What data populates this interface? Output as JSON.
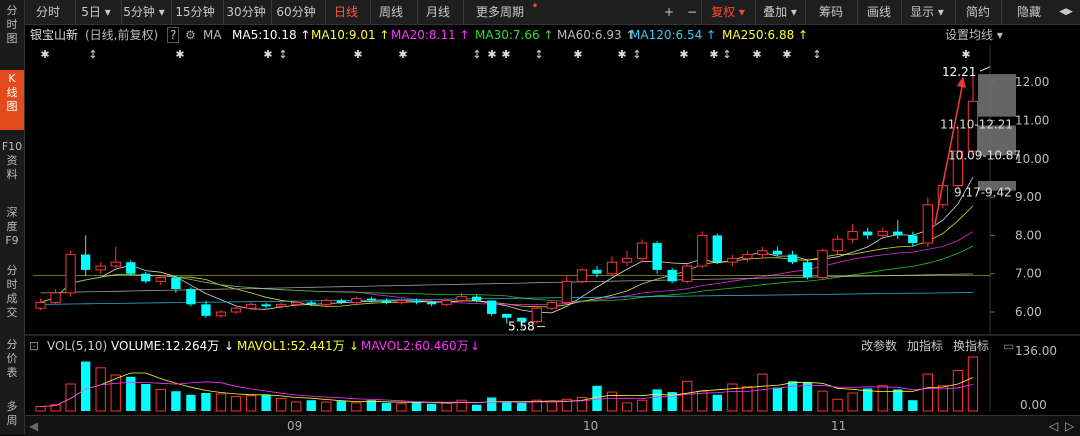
{
  "sidebar": [
    {
      "label": "分\n时\n图",
      "active": false
    },
    {
      "label": "K\n线\n图",
      "active": true
    },
    {
      "label": "F10\n资\n料",
      "active": false
    },
    {
      "label": "深\n度\nF9",
      "active": false
    },
    {
      "label": "分\n时\n成\n交",
      "active": false
    },
    {
      "label": "分\n价\n表",
      "active": false
    },
    {
      "label": "多\n周",
      "active": false
    }
  ],
  "toolbar": {
    "periods": [
      "分时",
      "5日",
      "5分钟",
      "15分钟",
      "30分钟",
      "60分钟",
      "日线",
      "周线",
      "月线",
      "更多周期"
    ],
    "active_period": "日线",
    "right": [
      "+",
      "−",
      "复权",
      "叠加",
      "筹码",
      "画线",
      "显示",
      "简约",
      "隐藏"
    ]
  },
  "info": {
    "stock": "银宝山新",
    "mode": "(日线,前复权)",
    "help": "?",
    "ma_label": "MA",
    "ma": [
      {
        "text": "MA5:10.18",
        "arrow": "↑",
        "color": "#ffffff"
      },
      {
        "text": "MA10:9.01",
        "arrow": "↑",
        "color": "#ffff33"
      },
      {
        "text": "MA20:8.11",
        "arrow": "↑",
        "color": "#ff33ff"
      },
      {
        "text": "MA30:7.66",
        "arrow": "↑",
        "color": "#33dd33"
      },
      {
        "text": "MA60:6.93",
        "arrow": "↑",
        "color": "#bbbbbb"
      },
      {
        "text": "MA120:6.54",
        "arrow": "↑",
        "color": "#33ccff"
      },
      {
        "text": "MA250:6.88",
        "arrow": "↑",
        "color": "#ffff33"
      }
    ],
    "settings": "设置均线"
  },
  "price_axis": [
    "12.00",
    "11.00",
    "10.00",
    "9.00",
    "8.00",
    "7.00",
    "6.00"
  ],
  "annotations": {
    "high": "12.21",
    "low": "5.58",
    "chip_ranges": [
      "11.10-12.21",
      "10.09-10.87",
      "9.17-9.42"
    ]
  },
  "volume": {
    "title": "VOL(5,10)",
    "volume": "VOLUME:12.264万",
    "mavol1": "MAVOL1:52.441万",
    "mavol2": "MAVOL2:60.460万",
    "buttons": [
      "改参数",
      "加指标",
      "换指标"
    ],
    "axis": [
      "136.00",
      "0.00"
    ]
  },
  "months": [
    "09",
    "10",
    "11"
  ],
  "colors": {
    "up": "#ff3333",
    "down": "#00ffff",
    "accent": "#ff5a36"
  },
  "chart_data": {
    "type": "candlestick",
    "candles": [
      [
        6.1,
        6.25,
        6.35,
        6.05
      ],
      [
        6.25,
        6.5,
        6.6,
        6.2
      ],
      [
        6.5,
        7.5,
        7.6,
        6.4
      ],
      [
        7.5,
        7.1,
        8.0,
        6.95
      ],
      [
        7.1,
        7.2,
        7.3,
        7.0
      ],
      [
        7.2,
        7.3,
        7.7,
        7.15
      ],
      [
        7.3,
        7.0,
        7.35,
        6.95
      ],
      [
        7.0,
        6.8,
        7.05,
        6.75
      ],
      [
        6.8,
        6.9,
        6.95,
        6.7
      ],
      [
        6.9,
        6.6,
        6.95,
        6.5
      ],
      [
        6.6,
        6.2,
        6.65,
        6.15
      ],
      [
        6.2,
        5.9,
        6.3,
        5.85
      ],
      [
        5.9,
        6.0,
        6.05,
        5.85
      ],
      [
        6.0,
        6.1,
        6.15,
        5.95
      ],
      [
        6.1,
        6.2,
        6.25,
        6.05
      ],
      [
        6.2,
        6.15,
        6.25,
        6.1
      ],
      [
        6.15,
        6.2,
        6.25,
        6.1
      ],
      [
        6.2,
        6.25,
        6.3,
        6.15
      ],
      [
        6.25,
        6.2,
        6.3,
        6.15
      ],
      [
        6.2,
        6.3,
        6.35,
        6.15
      ],
      [
        6.3,
        6.25,
        6.35,
        6.2
      ],
      [
        6.25,
        6.35,
        6.4,
        6.2
      ],
      [
        6.35,
        6.3,
        6.4,
        6.25
      ],
      [
        6.3,
        6.25,
        6.35,
        6.2
      ],
      [
        6.25,
        6.3,
        6.35,
        6.2
      ],
      [
        6.3,
        6.25,
        6.35,
        6.2
      ],
      [
        6.25,
        6.2,
        6.3,
        6.15
      ],
      [
        6.2,
        6.3,
        6.35,
        6.15
      ],
      [
        6.3,
        6.4,
        6.5,
        6.25
      ],
      [
        6.4,
        6.3,
        6.45,
        6.25
      ],
      [
        6.3,
        5.95,
        6.3,
        5.9
      ],
      [
        5.95,
        5.85,
        5.95,
        5.7
      ],
      [
        5.85,
        5.75,
        5.85,
        5.58
      ],
      [
        5.75,
        6.1,
        6.15,
        5.7
      ],
      [
        6.1,
        6.25,
        6.3,
        6.05
      ],
      [
        6.25,
        6.8,
        6.95,
        6.2
      ],
      [
        6.8,
        7.1,
        7.15,
        6.75
      ],
      [
        7.1,
        7.0,
        7.2,
        6.9
      ],
      [
        7.0,
        7.3,
        7.45,
        6.95
      ],
      [
        7.3,
        7.4,
        7.6,
        7.2
      ],
      [
        7.4,
        7.8,
        7.9,
        7.3
      ],
      [
        7.8,
        7.1,
        7.85,
        7.0
      ],
      [
        7.1,
        6.8,
        7.15,
        6.75
      ],
      [
        6.8,
        7.2,
        7.25,
        6.75
      ],
      [
        7.2,
        8.0,
        8.1,
        7.15
      ],
      [
        8.0,
        7.3,
        8.05,
        7.25
      ],
      [
        7.3,
        7.4,
        7.5,
        7.2
      ],
      [
        7.4,
        7.5,
        7.6,
        7.3
      ],
      [
        7.5,
        7.6,
        7.7,
        7.4
      ],
      [
        7.6,
        7.5,
        7.7,
        7.45
      ],
      [
        7.5,
        7.3,
        7.6,
        7.25
      ],
      [
        7.3,
        6.9,
        7.35,
        6.85
      ],
      [
        6.9,
        7.6,
        7.65,
        6.85
      ],
      [
        7.6,
        7.9,
        8.0,
        7.5
      ],
      [
        7.9,
        8.1,
        8.3,
        7.8
      ],
      [
        8.1,
        8.0,
        8.2,
        7.9
      ],
      [
        8.0,
        8.1,
        8.2,
        7.95
      ],
      [
        8.1,
        8.0,
        8.4,
        7.9
      ],
      [
        8.0,
        7.8,
        8.1,
        7.7
      ],
      [
        7.8,
        8.8,
        9.0,
        7.7
      ],
      [
        8.8,
        9.3,
        9.42,
        8.7
      ],
      [
        9.3,
        10.2,
        10.87,
        9.2
      ],
      [
        10.2,
        11.5,
        12.21,
        10.1
      ]
    ],
    "volumes": [
      5,
      7,
      30,
      55,
      48,
      40,
      38,
      30,
      24,
      22,
      18,
      20,
      19,
      16,
      17,
      18,
      14,
      10,
      12,
      10,
      11,
      9,
      12,
      9,
      8,
      10,
      8,
      9,
      12,
      7,
      15,
      10,
      9,
      12,
      10,
      13,
      15,
      28,
      21,
      9,
      12,
      24,
      21,
      33,
      22,
      18,
      30,
      27,
      41,
      26,
      33,
      32,
      22,
      13,
      20,
      25,
      28,
      24,
      12,
      41,
      28,
      45,
      60
    ],
    "ylim": [
      5.4,
      12.5
    ]
  }
}
